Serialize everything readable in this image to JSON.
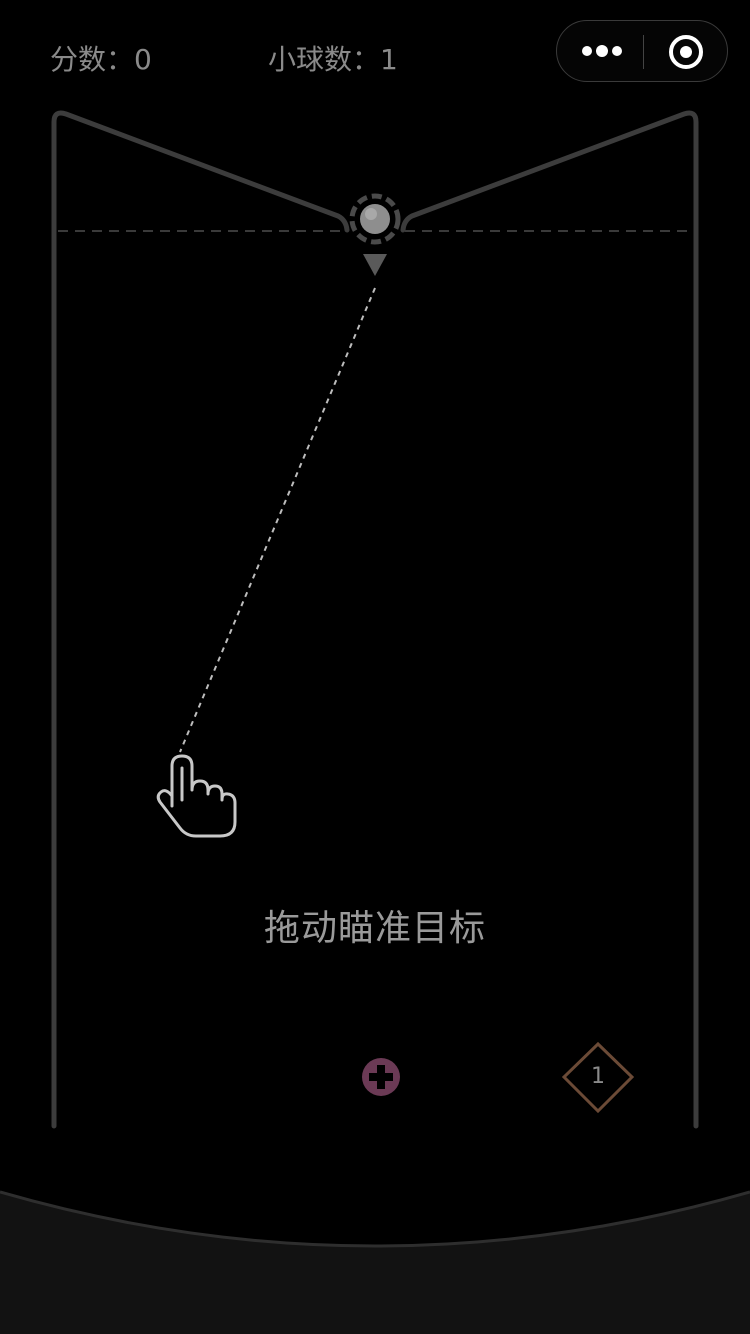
{
  "hud": {
    "score_text": "分数：0",
    "balls_text": "小球数：1"
  },
  "game": {
    "hint": "拖动瞄准目标",
    "target_block_number": "1"
  },
  "icons": {
    "more": "more-dots-icon",
    "close": "target-circle-icon",
    "launcher": "launcher-ball-icon",
    "aim_arrow": "down-triangle-icon",
    "hand": "hand-pointer-icon",
    "extra_ball": "plus-circle-icon",
    "block": "diamond-block-icon"
  },
  "colors": {
    "background": "#000000",
    "frame": "#3c3c3c",
    "hud_text": "#8a8a8a",
    "aim_line": "#bdbdbd",
    "extra_ball": "#6b3a55",
    "block_outline": "#6b4a36"
  }
}
